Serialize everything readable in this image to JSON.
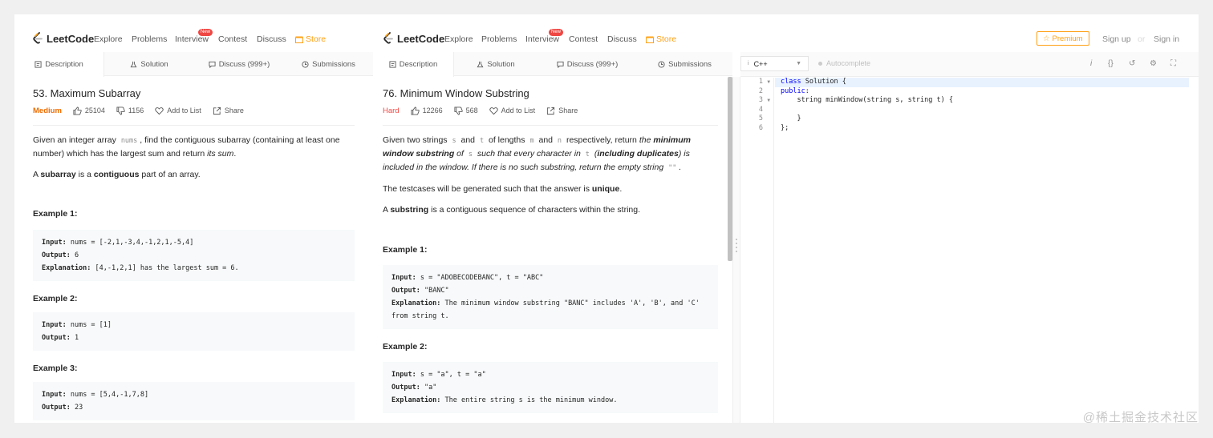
{
  "left": {
    "nav": {
      "logo": "LeetCode",
      "links": [
        "Explore",
        "Problems",
        "Interview",
        "Contest",
        "Discuss",
        "Store"
      ],
      "new_badge": "New"
    },
    "tabs": [
      "Description",
      "Solution",
      "Discuss (999+)",
      "Submissions"
    ],
    "problem": {
      "title": "53. Maximum Subarray",
      "difficulty": "Medium",
      "likes": "25104",
      "dislikes": "1156",
      "add_to_list": "Add to List",
      "share": "Share",
      "desc_1a": "Given an integer array ",
      "desc_1code": "nums",
      "desc_1b": ", find the contiguous subarray (containing at least one number) which has the largest sum and return ",
      "desc_1c": "its sum",
      "desc_1d": ".",
      "desc_2a": "A ",
      "desc_2b": "subarray",
      "desc_2c": " is a ",
      "desc_2d": "contiguous",
      "desc_2e": " part of an array.",
      "examples": [
        {
          "title": "Example 1:",
          "input": "nums = [-2,1,-3,4,-1,2,1,-5,4]",
          "output": "6",
          "explanation": "[4,-1,2,1] has the largest sum = 6."
        },
        {
          "title": "Example 2:",
          "input": "nums = [1]",
          "output": "1"
        },
        {
          "title": "Example 3:",
          "input": "nums = [5,4,-1,7,8]",
          "output": "23"
        }
      ]
    }
  },
  "right": {
    "nav": {
      "logo": "LeetCode",
      "links": [
        "Explore",
        "Problems",
        "Interview",
        "Contest",
        "Discuss",
        "Store"
      ],
      "new_badge": "New",
      "premium": "Premium",
      "sign_up": "Sign up",
      "or": "or",
      "sign_in": "Sign in"
    },
    "tabs": [
      "Description",
      "Solution",
      "Discuss (999+)",
      "Submissions"
    ],
    "problem": {
      "title": "76. Minimum Window Substring",
      "difficulty": "Hard",
      "likes": "12266",
      "dislikes": "568",
      "add_to_list": "Add to List",
      "share": "Share",
      "d1_a": "Given two strings ",
      "d1_s": "s",
      "d1_b": " and ",
      "d1_t": "t",
      "d1_c": " of lengths ",
      "d1_m": "m",
      "d1_d": " and ",
      "d1_n": "n",
      "d1_e": " respectively, return ",
      "d1_f": "the ",
      "d1_g": "minimum window substring",
      "d1_h": " of ",
      "d1_s2": "s",
      "d1_i": " such that every character in ",
      "d1_t2": "t",
      "d1_j": " (",
      "d1_k": "including duplicates",
      "d1_l": ") is included in the window. If there is no such substring, return the empty string ",
      "d1_empty": "\"\"",
      "d1_end": ".",
      "d2_a": "The testcases will be generated such that the answer is ",
      "d2_b": "unique",
      "d2_c": ".",
      "d3_a": "A ",
      "d3_b": "substring",
      "d3_c": " is a contiguous sequence of characters within the string.",
      "examples": [
        {
          "title": "Example 1:",
          "input": "s = \"ADOBECODEBANC\", t = \"ABC\"",
          "output": "\"BANC\"",
          "explanation": "The minimum window substring \"BANC\" includes 'A', 'B', and 'C' from string t."
        },
        {
          "title": "Example 2:",
          "input": "s = \"a\", t = \"a\"",
          "output": "\"a\"",
          "explanation": "The entire string s is the minimum window."
        }
      ]
    },
    "editor": {
      "language": "C++",
      "autocomplete": "Autocomplete",
      "line_numbers": [
        "1",
        "2",
        "3",
        "4",
        "5",
        "6"
      ],
      "lines": [
        {
          "kw": "class",
          "rest": " Solution {"
        },
        {
          "kw": "public",
          "rest": ":"
        },
        {
          "kw": "",
          "rest": "    string minWindow(string s, string t) {"
        },
        {
          "kw": "",
          "rest": ""
        },
        {
          "kw": "",
          "rest": "    }"
        },
        {
          "kw": "",
          "rest": "};"
        }
      ]
    }
  },
  "labels": {
    "input": "Input:",
    "output": "Output:",
    "explanation": "Explanation:"
  },
  "watermark": "@稀土掘金技术社区",
  "colors": {
    "store": "#ffa116",
    "medium": "#ef6c00",
    "hard": "#ef4743",
    "keyword": "#0000ff"
  }
}
